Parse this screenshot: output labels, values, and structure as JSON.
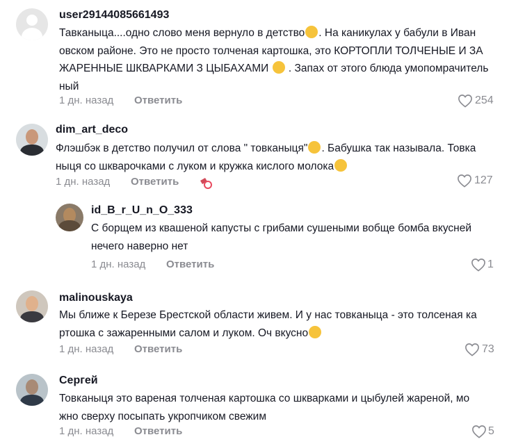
{
  "comments": [
    {
      "username": "user2914408566149​3",
      "lines": [
        "Тавканыца....одно слово меня вернуло в детство",
        "овском районе. Это не просто толченая картошка, это КОРТОПЛИ ТОЛЧЕНЫЕ И ЗА",
        "ЖАРЕННЫЕ ШКВАРКАМИ З ЦЫБАХАМИ",
        "ный"
      ],
      "line1_suffix": ". На каникулах у бабули в Иван",
      "line3_suffix": ". Запах от этого блюда умопомрачитель",
      "time": "1 дн. назад",
      "reply": "Ответить",
      "likes": "254"
    },
    {
      "username": "dim_art_deco",
      "line1": "Флэшбэк в детство получил от слова \" товканыця\"",
      "line1_suffix": ". Бабушка так называла. Товка",
      "line2": "ныця со шкварочками с луком и кружка кислого молока",
      "time": "1 дн. назад",
      "reply": "Ответить",
      "likes": "127"
    },
    {
      "username": "id_B_r_U_n_O_333",
      "line1": "С борщем из квашеной капусты с грибами сушеными вобще бомба вкусней",
      "line2": "нечего наверно нет",
      "time": "1 дн. назад",
      "reply": "Ответить",
      "likes": "1"
    },
    {
      "username": "malinouskaya",
      "line1": "Мы ближе к Березе Брестской области живем. И у нас товканыца - это толсеная ка",
      "line2": "ртошка с зажаренными салом и луком. Оч вкусно",
      "time": "1 дн. назад",
      "reply": "Ответить",
      "likes": "73"
    },
    {
      "username": "Сергей",
      "line1": "Товканыця это вареная толченая картошка со шкварками и цыбулей жареной, мо",
      "line2": "жно сверху посыпать укропчиком свежим",
      "time": "1 дн. назад",
      "reply": "Ответить",
      "likes": "5"
    }
  ],
  "colors": {
    "text": "#161823",
    "muted": "#8a8b91"
  }
}
